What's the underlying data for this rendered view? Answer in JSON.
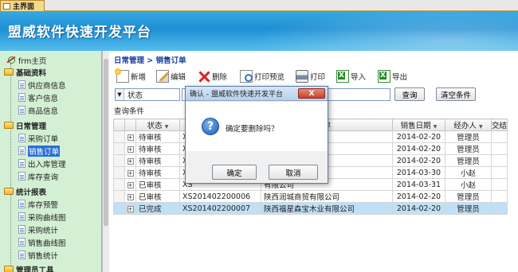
{
  "tab": {
    "label": "主界面"
  },
  "banner": {
    "title": "盟威软件快速开发平台"
  },
  "sidebar": {
    "items": [
      {
        "label": "frm主页",
        "kind": "frm"
      },
      {
        "label": "基础资料",
        "kind": "group"
      },
      {
        "label": "供应商信息",
        "kind": "doc"
      },
      {
        "label": "客户信息",
        "kind": "doc"
      },
      {
        "label": "商品信息",
        "kind": "doc"
      },
      {
        "label": "日常管理",
        "kind": "group"
      },
      {
        "label": "采购订单",
        "kind": "doc"
      },
      {
        "label": "销售订单",
        "kind": "doc",
        "selected": true
      },
      {
        "label": "出入库管理",
        "kind": "doc"
      },
      {
        "label": "库存查询",
        "kind": "doc"
      },
      {
        "label": "统计报表",
        "kind": "group"
      },
      {
        "label": "库存预警",
        "kind": "doc"
      },
      {
        "label": "采购曲线图",
        "kind": "doc"
      },
      {
        "label": "采购统计",
        "kind": "doc"
      },
      {
        "label": "销售曲线图",
        "kind": "doc"
      },
      {
        "label": "销售统计",
        "kind": "doc"
      },
      {
        "label": "管理员工具",
        "kind": "group"
      }
    ]
  },
  "main": {
    "breadcrumb": "日常管理 > 销售订单",
    "toolbar": {
      "new": "新增",
      "edit": "编辑",
      "delete": "删除",
      "print_preview": "打印预览",
      "print": "打印",
      "import": "导入",
      "export": "导出"
    },
    "search": {
      "field_value": "状态",
      "query_button": "查询",
      "clear_button": "清空条件"
    },
    "conditions_label": "查询条件",
    "grid": {
      "columns": [
        "状态",
        "",
        "称",
        "销售日期",
        "经办人",
        "交结"
      ],
      "rows": [
        {
          "status": "待审核",
          "order_no": "XS",
          "customer": "有限公司",
          "date": "2014-02-20",
          "manager": "管理员"
        },
        {
          "status": "待审核",
          "order_no": "XS",
          "customer": "有限公司",
          "date": "2014-02-20",
          "manager": "管理员"
        },
        {
          "status": "待审核",
          "order_no": "XS",
          "customer": "有限公司",
          "date": "2014-02-20",
          "manager": "管理员"
        },
        {
          "status": "待审核",
          "order_no": "XS",
          "customer": "有限公司",
          "date": "2014-03-30",
          "manager": "小赵"
        },
        {
          "status": "已审核",
          "order_no": "XS",
          "customer": "有限公司",
          "date": "2014-03-31",
          "manager": "小赵"
        },
        {
          "status": "已审核",
          "order_no": "XS201402200006",
          "customer": "陕西润城商贸有限公司",
          "date": "2014-02-20",
          "manager": "管理员"
        },
        {
          "status": "已完成",
          "order_no": "XS201402200007",
          "customer": "陕西福星森宝木业有限公司",
          "date": "2014-02-20",
          "manager": "管理员",
          "selected": true
        }
      ]
    }
  },
  "dialog": {
    "title": "确认 - 盟威软件快速开发平台",
    "close_glyph": "X",
    "message": "确定要删除吗？",
    "ok": "确定",
    "cancel": "取消"
  }
}
